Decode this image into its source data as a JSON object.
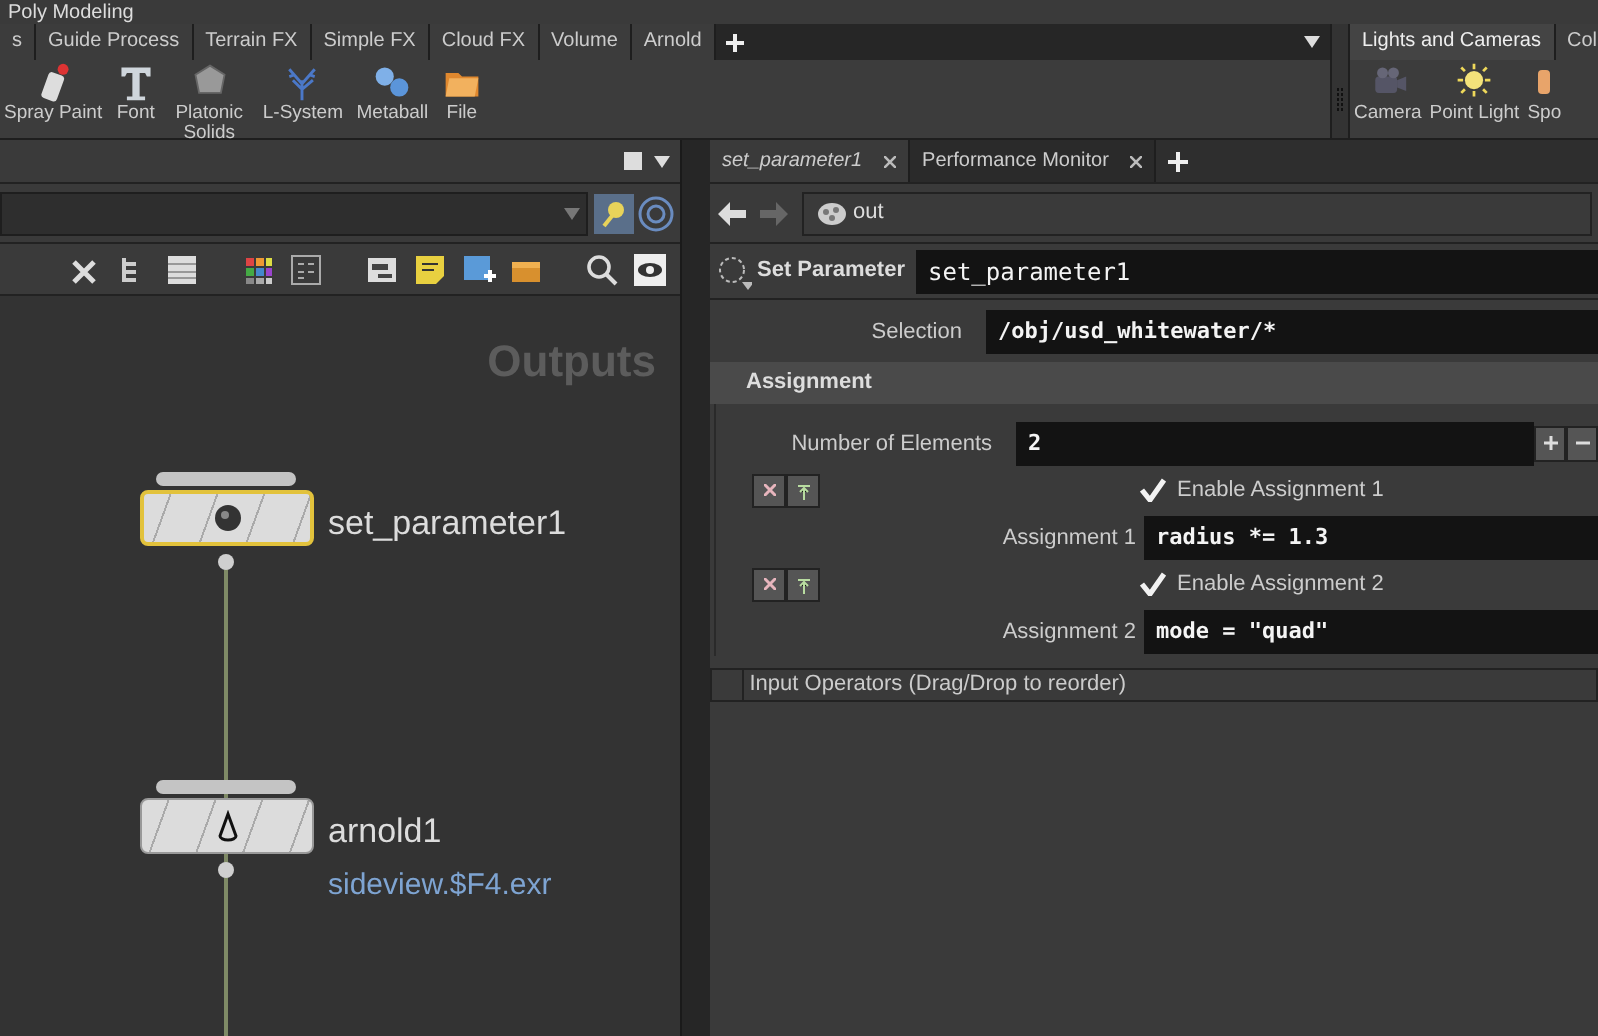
{
  "desktop": {
    "title": "Poly Modeling"
  },
  "shelf_tabs": [
    {
      "label": "s",
      "selected": false
    },
    {
      "label": "Guide Process",
      "selected": false
    },
    {
      "label": "Terrain FX",
      "selected": false
    },
    {
      "label": "Simple FX",
      "selected": false
    },
    {
      "label": "Cloud FX",
      "selected": false
    },
    {
      "label": "Volume",
      "selected": false
    },
    {
      "label": "Arnold",
      "selected": false
    }
  ],
  "shelf_tools": [
    {
      "label": "Spray Paint",
      "kind": "spray"
    },
    {
      "label": "Font",
      "kind": "font"
    },
    {
      "label": "Platonic Solids",
      "kind": "solid"
    },
    {
      "label": "L-System",
      "kind": "tree"
    },
    {
      "label": "Metaball",
      "kind": "metaball"
    },
    {
      "label": "File",
      "kind": "file"
    }
  ],
  "right_shelf_tabs": [
    {
      "label": "Lights and Cameras",
      "selected": true
    },
    {
      "label": "Col",
      "selected": false
    }
  ],
  "right_shelf_tools": [
    {
      "label": "Camera",
      "kind": "camera"
    },
    {
      "label": "Point Light",
      "kind": "light"
    },
    {
      "label": "Spo",
      "kind": "spot"
    }
  ],
  "network": {
    "title": "Outputs",
    "nodes": [
      {
        "name": "set_parameter1",
        "kind": "setparam",
        "selected": true
      },
      {
        "name": "arnold1",
        "kind": "arnold",
        "selected": false,
        "output": "sideview.$F4.exr"
      }
    ]
  },
  "param_tabs": [
    {
      "label": "set_parameter1",
      "selected": true
    },
    {
      "label": "Performance Monitor",
      "selected": false
    }
  ],
  "path": "out",
  "node": {
    "type": "Set Parameter",
    "name": "set_parameter1"
  },
  "selection": {
    "label": "Selection",
    "value": "/obj/usd_whitewater/*"
  },
  "folder": {
    "title": "Assignment",
    "count_label": "Number of Elements",
    "count": "2",
    "entries": [
      {
        "enable_label": "Enable Assignment 1",
        "enabled": true,
        "label": "Assignment 1",
        "value": "radius *= 1.3"
      },
      {
        "enable_label": "Enable Assignment 2",
        "enabled": true,
        "label": "Assignment 2",
        "value": "mode = \"quad\""
      }
    ]
  },
  "input_operators": {
    "title": "Input Operators (Drag/Drop to reorder)"
  }
}
